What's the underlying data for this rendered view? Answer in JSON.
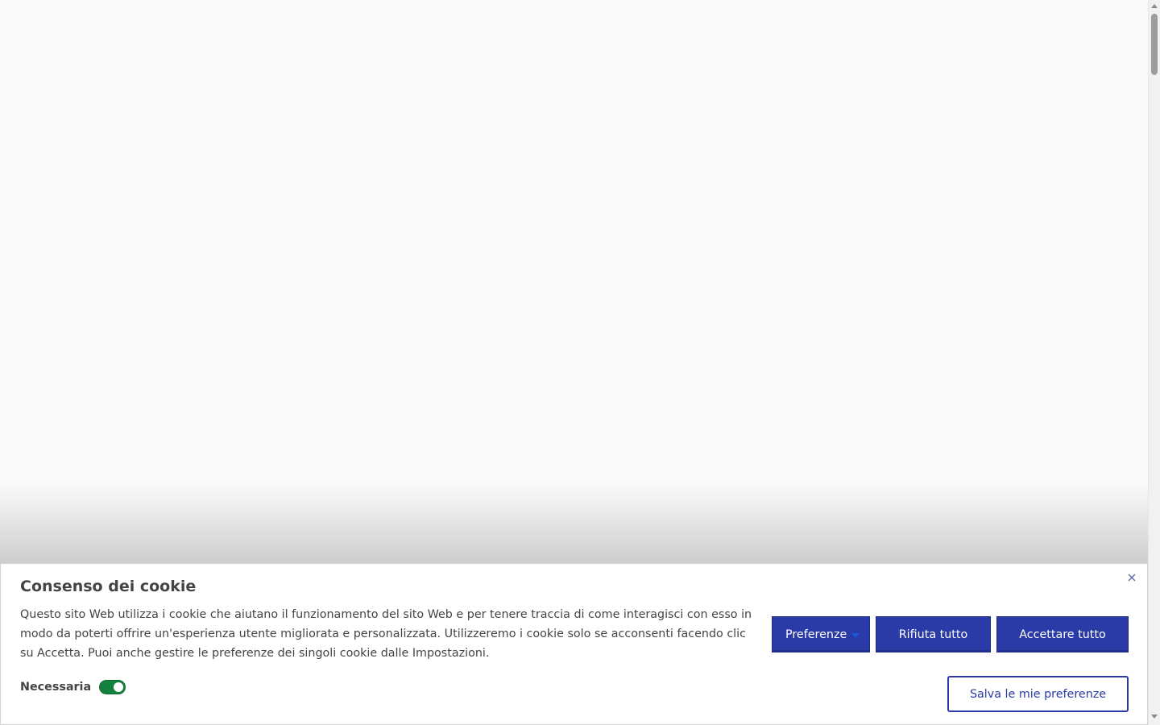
{
  "cookie_banner": {
    "title": "Consenso dei cookie",
    "description": "Questo sito Web utilizza i cookie che aiutano il funzionamento del sito Web e per tenere traccia di come interagisci con esso in modo da poterti offrire un'esperienza utente migliorata e personalizzata. Utilizzeremo i cookie solo se acconsenti facendo clic su Accetta. Puoi anche gestire le preferenze dei singoli cookie dalle Impostazioni.",
    "close_icon": "close-icon",
    "toggle": {
      "label": "Necessaria",
      "state": "on",
      "color": "#14813c"
    },
    "buttons": {
      "preferences": "Preferenze",
      "reject_all": "Rifiuta tutto",
      "accept_all": "Accettare tutto",
      "save_preferences": "Salva le mie preferenze"
    },
    "accent_color": "#2a3aa6"
  }
}
